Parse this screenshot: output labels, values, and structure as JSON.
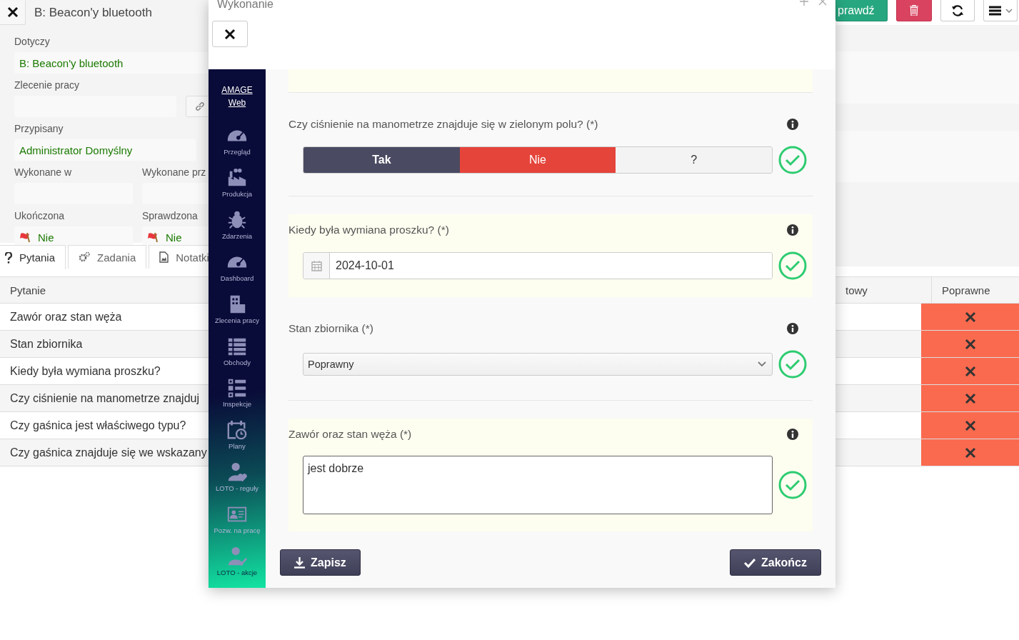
{
  "page": {
    "title": "B: Beacon'y bluetooth",
    "toolbar": [
      {
        "kind": "verify",
        "label": "prawdź"
      },
      {
        "kind": "delete"
      },
      {
        "kind": "refresh"
      },
      {
        "kind": "menu"
      }
    ],
    "form_rows": [
      [
        {
          "label": "Dotyczy",
          "kind": "text",
          "value": "B: Beacon'y bluetooth"
        }
      ],
      [
        {
          "label": "Zlecenie pracy",
          "kind": "link"
        }
      ],
      [
        {
          "label": "Przypisany",
          "kind": "text",
          "value": "Administrator Domyślny"
        }
      ],
      [
        {
          "label": "Wykonane w",
          "kind": "text"
        },
        {
          "label": "Wykonane prz",
          "kind": "text"
        }
      ],
      [
        {
          "label": "Ukończona",
          "kind": "flag",
          "value": "Nie"
        },
        {
          "label": "Sprawdzona",
          "kind": "flag",
          "value": "Nie"
        }
      ]
    ],
    "tabs": [
      {
        "label": "Pytania",
        "kind": "questions",
        "selected": true
      },
      {
        "label": "Zadania",
        "kind": "tasks",
        "selected": false
      },
      {
        "label": "Notatki",
        "kind": "notes",
        "selected": false
      }
    ],
    "table": {
      "columns": [
        "Pytanie",
        "towy",
        "Poprawne"
      ],
      "rows": [
        {
          "question": "Zawór oraz stan węża",
          "correct": false
        },
        {
          "question": "Stan zbiornika",
          "correct": false
        },
        {
          "question": "Kiedy była wymiana proszku?",
          "correct": false
        },
        {
          "question": "Czy ciśnienie na manometrze znajduj",
          "correct": false
        },
        {
          "question": "Czy gaśnica jest właściwego typu?",
          "correct": false
        },
        {
          "question": "Czy gaśnica znajduje się we wskazany",
          "correct": false
        }
      ]
    }
  },
  "modal": {
    "title": "Wykonanie",
    "nav": {
      "brand": "AMAGE Web",
      "items": [
        {
          "label": "Przegląd",
          "kind": "gauge"
        },
        {
          "label": "Produkcja",
          "kind": "factory"
        },
        {
          "label": "Zdarzenia",
          "kind": "bug"
        },
        {
          "label": "Dashboard",
          "kind": "gauge"
        },
        {
          "label": "Zlecenia pracy",
          "kind": "building"
        },
        {
          "label": "Obchody",
          "kind": "list"
        },
        {
          "label": "Inspekcje",
          "kind": "checklist"
        },
        {
          "label": "Plany",
          "kind": "calendar"
        },
        {
          "label": "LOTO - reguły",
          "kind": "user-heart"
        },
        {
          "label": "Pozw. na pracę",
          "kind": "id-card"
        },
        {
          "label": "LOTO - akcje",
          "kind": "user-check"
        }
      ]
    },
    "questions": [
      {
        "kind": "choice",
        "label": "Czy ciśnienie na manometrze znajduje się w zielonym polu? (*)",
        "highlighted": false,
        "valid": true,
        "options": [
          {
            "label": "Tak",
            "selected": true,
            "color": "#4a4a62"
          },
          {
            "label": "Nie",
            "selected": false,
            "color": "#e5443a"
          },
          {
            "label": "?",
            "selected": false,
            "color": "#f3f3f3"
          }
        ]
      },
      {
        "kind": "date",
        "label": "Kiedy była wymiana proszku? (*)",
        "highlighted": true,
        "valid": true,
        "value": "2024-10-01"
      },
      {
        "kind": "select",
        "label": "Stan zbiornika (*)",
        "highlighted": false,
        "valid": true,
        "value": "Poprawny"
      },
      {
        "kind": "text",
        "label": "Zawór oraz stan węża (*)",
        "highlighted": true,
        "valid": true,
        "value": "jest dobrze"
      }
    ],
    "save": "Zapisz",
    "finish": "Zakończ"
  }
}
